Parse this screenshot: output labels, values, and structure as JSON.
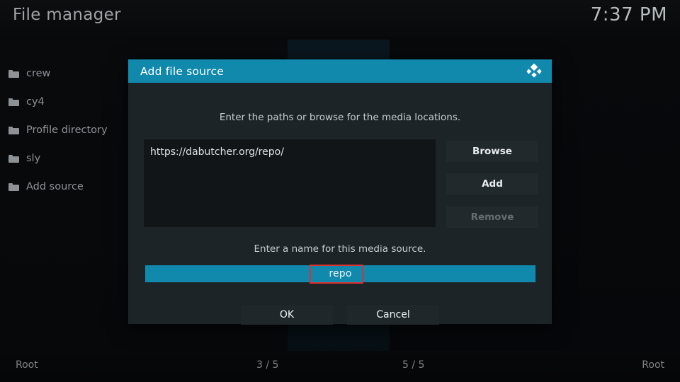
{
  "window": {
    "app_title": "File manager",
    "clock": "7:37 PM"
  },
  "sidebar": {
    "items": [
      {
        "label": "crew",
        "icon": "folder-icon"
      },
      {
        "label": "cy4",
        "icon": "folder-icon"
      },
      {
        "label": "Profile directory",
        "icon": "folder-icon"
      },
      {
        "label": "sly",
        "icon": "folder-icon"
      },
      {
        "label": "Add source",
        "icon": "folder-icon"
      }
    ]
  },
  "dialog": {
    "title": "Add file source",
    "logo_icon": "kodi-logo-icon",
    "hint_paths": "Enter the paths or browse for the media locations.",
    "hint_name": "Enter a name for this media source.",
    "path_entries": [
      "https://dabutcher.org/repo/"
    ],
    "side_buttons": [
      {
        "label": "Browse",
        "state": "enabled"
      },
      {
        "label": "Add",
        "state": "enabled"
      },
      {
        "label": "Remove",
        "state": "disabled"
      }
    ],
    "name_value": "repo",
    "ok_label": "OK",
    "cancel_label": "Cancel"
  },
  "status_bar": {
    "left": "Root",
    "center_left": "3 / 5",
    "center_right": "5 / 5",
    "right": "Root"
  },
  "colors": {
    "accent_teal": "#1089ad",
    "dialog_bg": "#1d2428",
    "field_bg": "#121517",
    "annotation_red": "#e0302e",
    "text_primary": "#e9edf0",
    "text_muted": "#8e9397"
  }
}
